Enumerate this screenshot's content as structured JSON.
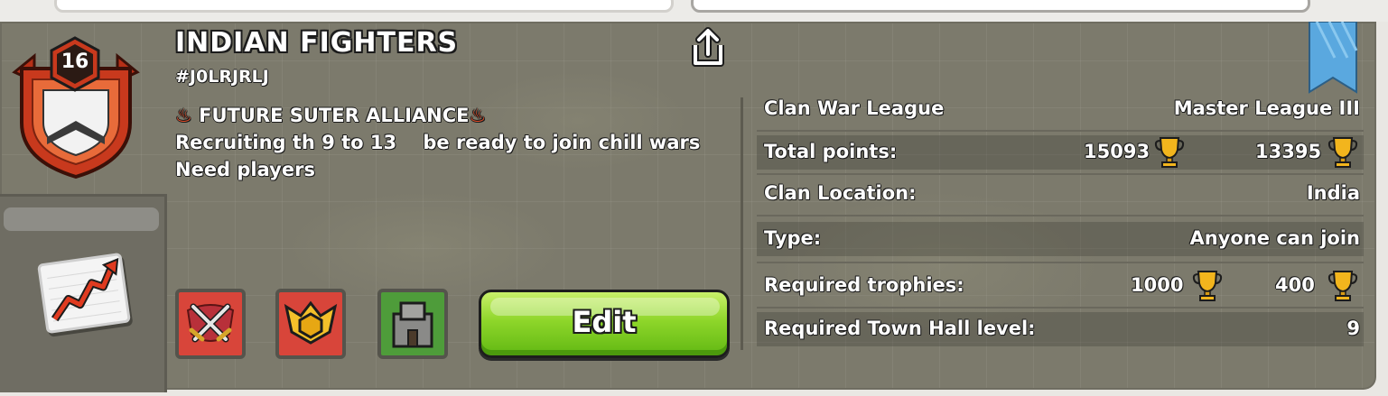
{
  "clan": {
    "level": "16",
    "name": "INDIAN FIGHTERS",
    "tag": "#J0LRJRLJ",
    "description_line1": "FUTURE SUTER ALLIANCE",
    "description_fire": "♨",
    "description_line2": "Recruiting th 9 to 13    be ready to join chill wars",
    "description_line3": "Need players"
  },
  "info": {
    "war_league_label": "Clan War League",
    "war_league_value": "Master League III",
    "total_points_label": "Total points:",
    "total_points_main": "15093",
    "total_points_builder": "13395",
    "location_label": "Clan Location:",
    "location_value": "India",
    "type_label": "Type:",
    "type_value": "Anyone can join",
    "req_trophies_label": "Required trophies:",
    "req_trophies_main": "1000",
    "req_trophies_builder": "400",
    "req_th_label": "Required Town Hall level:",
    "req_th_value": "9"
  },
  "buttons": {
    "edit_label": "Edit"
  },
  "icons": {
    "share": "share-icon",
    "war": "crossed-swords-icon",
    "league": "league-badge-icon",
    "capital": "capital-castle-icon",
    "trophy": "trophy-icon",
    "chart": "trend-chart-icon"
  },
  "colors": {
    "panel_bg": "#7c7a6c",
    "badge_red": "#c8391d",
    "edit_green": "#8ed62a",
    "banner_blue": "#5aa8df",
    "trophy_gold": "#f2b51d"
  }
}
